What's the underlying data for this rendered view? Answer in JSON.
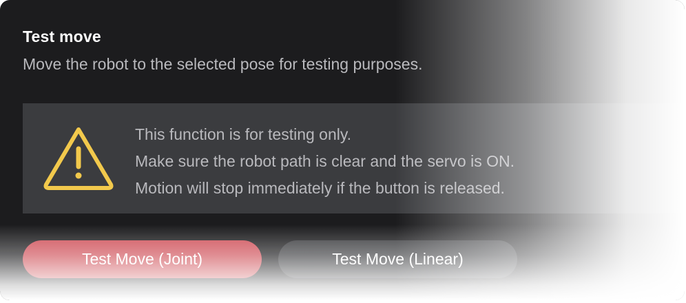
{
  "section": {
    "title": "Test move",
    "description": "Move the robot to the selected pose for testing purposes."
  },
  "warning": {
    "icon": "warning-triangle-icon",
    "icon_color": "#f2c94c",
    "lines": [
      "This function is for testing only.",
      "Make sure the robot path is clear and the servo is ON.",
      "Motion will stop immediately if the button is released."
    ]
  },
  "buttons": {
    "joint_label": "Test Move (Joint)",
    "linear_label": "Test Move (Linear)"
  },
  "colors": {
    "background": "#1c1c1e",
    "warning_background": "#3b3c3f",
    "primary_button": "#cf4f58",
    "secondary_button": "#3c3d40"
  }
}
